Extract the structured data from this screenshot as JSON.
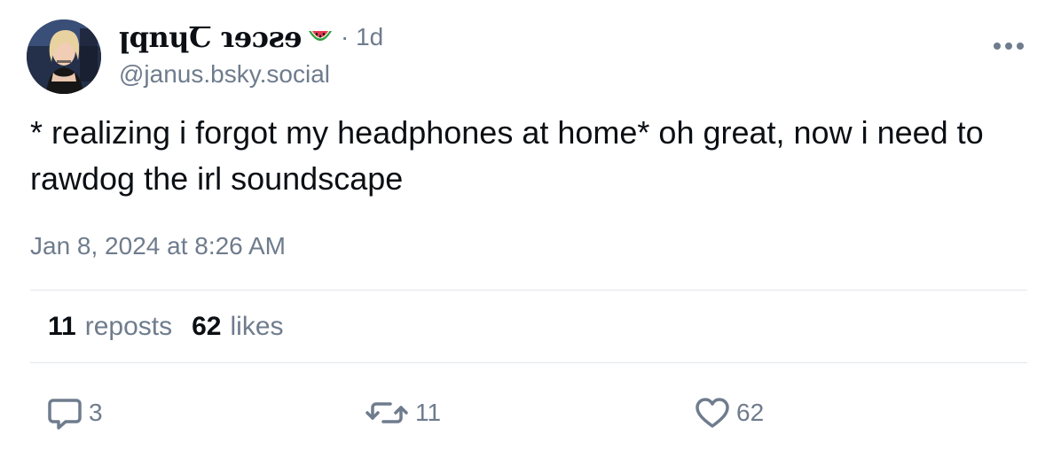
{
  "post": {
    "author": {
      "display_name": "ꞁqnɥꞆ ɿɘɔƨɘ",
      "emoji": "watermelon",
      "handle": "@janus.bsky.social"
    },
    "relative_time": "· 1d",
    "text": "* realizing i forgot my headphones at home* oh great, now i need to rawdog the irl soundscape",
    "timestamp": "Jan 8, 2024 at 8:26 AM",
    "stats": {
      "reposts_count": "11",
      "reposts_label": "reposts",
      "likes_count": "62",
      "likes_label": "likes"
    },
    "actions": {
      "reply_count": "3",
      "repost_count": "11",
      "like_count": "62"
    }
  },
  "icons": {
    "more": "more-horizontal-icon",
    "reply": "speech-bubble-icon",
    "repost": "repost-arrows-icon",
    "like": "heart-icon"
  },
  "colors": {
    "text": "#0b0f14",
    "muted": "#6f7c8d",
    "divider": "#e3e7ec"
  }
}
